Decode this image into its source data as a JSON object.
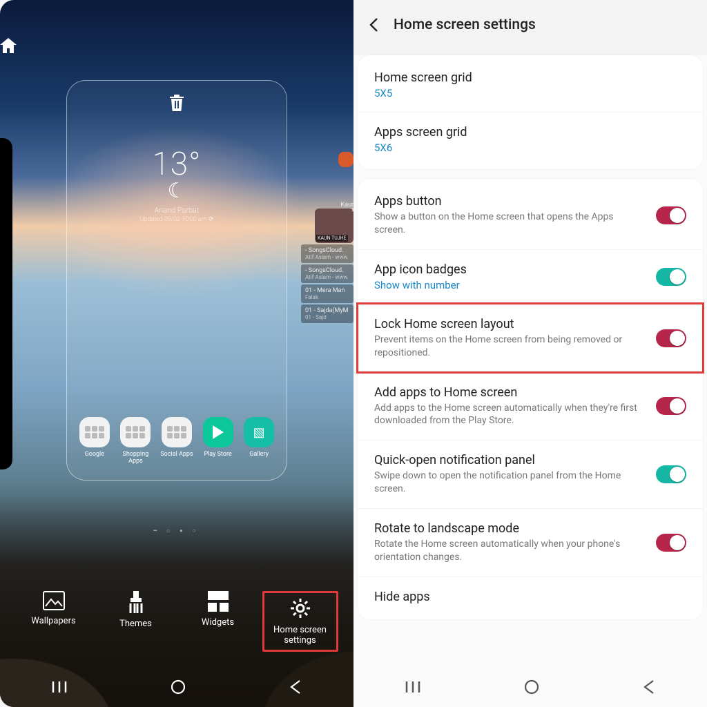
{
  "left": {
    "weather": {
      "temp": "13°",
      "location": "Anand Parbat",
      "updated": "Updated 09/02 10:00 am ⟳"
    },
    "side_tracks": [
      {
        "title": "- SongsCloud.",
        "artist": "Atif Aslam - www."
      },
      {
        "title": "- SongsCloud.",
        "artist": "Atif Aslam - www."
      },
      {
        "title": "01 - Mera Man",
        "artist": "Falak"
      },
      {
        "title": "01 - Sajda(MyM",
        "artist": "01 - Sajd"
      }
    ],
    "side_thumb_caption": "KAUN TUJHE",
    "side_thumb_header": "Kaur",
    "apps": [
      {
        "label": "Google"
      },
      {
        "label": "Shopping Apps"
      },
      {
        "label": "Social Apps"
      },
      {
        "label": "Play Store"
      },
      {
        "label": "Gallery"
      }
    ],
    "bottom": [
      {
        "label": "Wallpapers"
      },
      {
        "label": "Themes"
      },
      {
        "label": "Widgets"
      },
      {
        "label": "Home screen settings"
      }
    ]
  },
  "right": {
    "title": "Home screen settings",
    "grid": {
      "home": {
        "title": "Home screen grid",
        "value": "5X5"
      },
      "apps": {
        "title": "Apps screen grid",
        "value": "5X6"
      }
    },
    "items": {
      "apps_button": {
        "title": "Apps button",
        "sub": "Show a button on the Home screen that opens the Apps screen."
      },
      "badges": {
        "title": "App icon badges",
        "value": "Show with number"
      },
      "lock": {
        "title": "Lock Home screen layout",
        "sub": "Prevent items on the Home screen from being removed or repositioned."
      },
      "add": {
        "title": "Add apps to Home screen",
        "sub": "Add apps to the Home screen automatically when they're first downloaded from the Play Store."
      },
      "quick": {
        "title": "Quick-open notification panel",
        "sub": "Swipe down to open the notification panel from the Home screen."
      },
      "rotate": {
        "title": "Rotate to landscape mode",
        "sub": "Rotate the Home screen automatically when your phone's orientation changes."
      },
      "hide": {
        "title": "Hide apps"
      }
    }
  }
}
